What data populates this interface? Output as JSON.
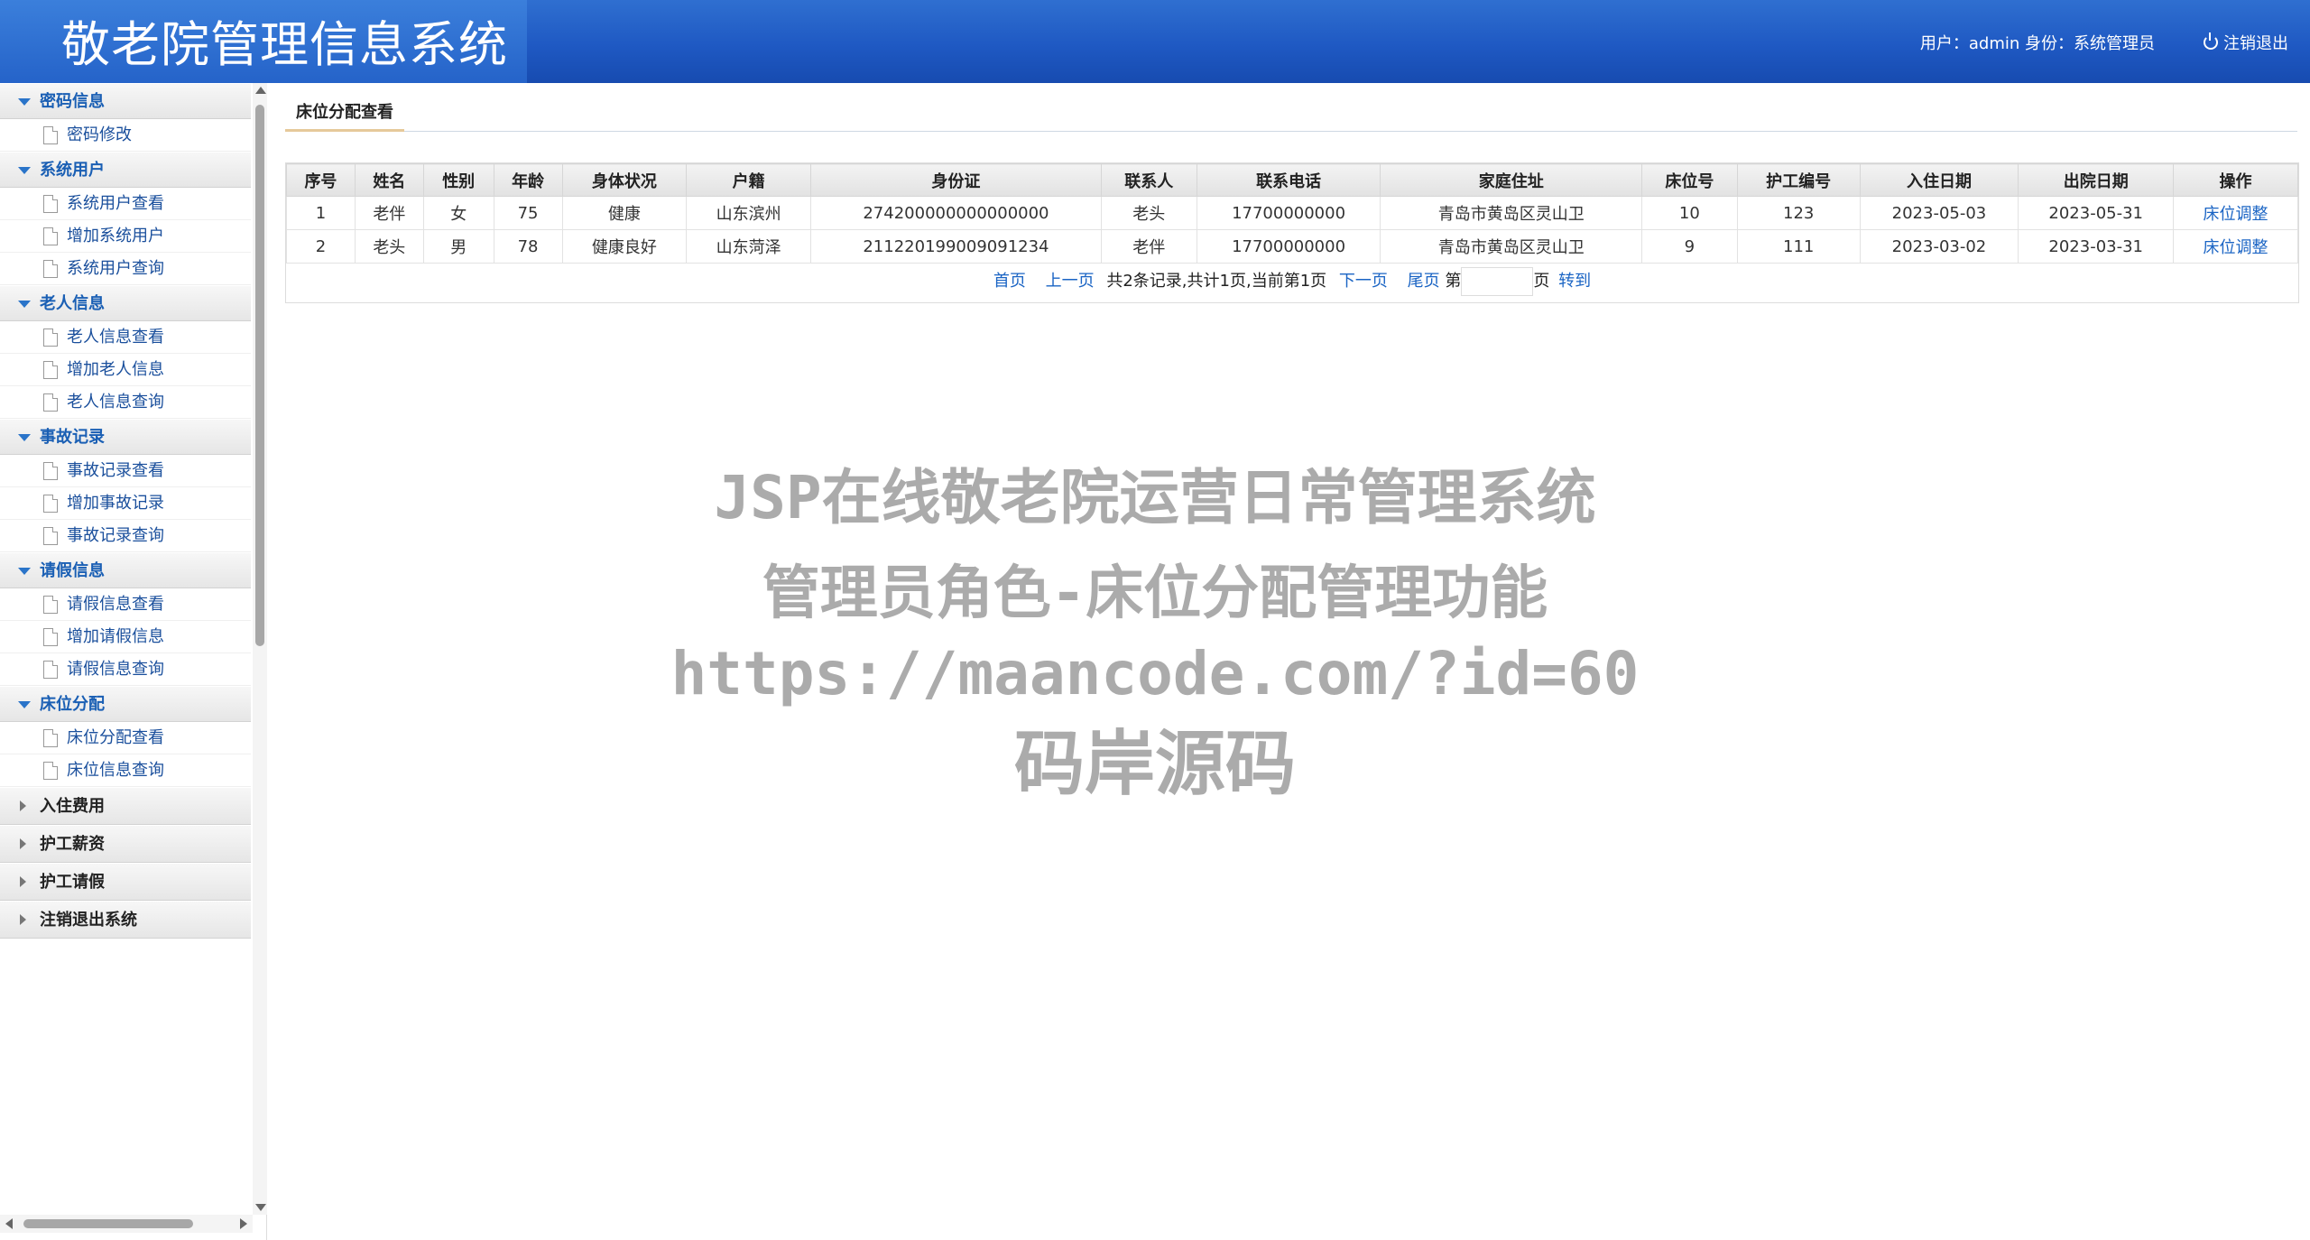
{
  "header": {
    "title": "敬老院管理信息系统",
    "user_info": "用户：admin 身份：系统管理员",
    "logout_label": "注销退出"
  },
  "sidebar": {
    "groups": [
      {
        "label": "密码信息",
        "items": [
          "密码修改"
        ]
      },
      {
        "label": "系统用户",
        "items": [
          "系统用户查看",
          "增加系统用户",
          "系统用户查询"
        ]
      },
      {
        "label": "老人信息",
        "items": [
          "老人信息查看",
          "增加老人信息",
          "老人信息查询"
        ]
      },
      {
        "label": "事故记录",
        "items": [
          "事故记录查看",
          "增加事故记录",
          "事故记录查询"
        ]
      },
      {
        "label": "请假信息",
        "items": [
          "请假信息查看",
          "增加请假信息",
          "请假信息查询"
        ]
      },
      {
        "label": "床位分配",
        "items": [
          "床位分配查看",
          "床位信息查询"
        ]
      }
    ],
    "collapsed": [
      "入住费用",
      "护工薪资",
      "护工请假",
      "注销退出系统"
    ]
  },
  "main": {
    "tab_label": "床位分配查看",
    "table": {
      "headers": [
        "序号",
        "姓名",
        "性别",
        "年龄",
        "身体状况",
        "户籍",
        "身份证",
        "联系人",
        "联系电话",
        "家庭住址",
        "床位号",
        "护工编号",
        "入住日期",
        "出院日期",
        "操作"
      ],
      "rows": [
        [
          "1",
          "老伴",
          "女",
          "75",
          "健康",
          "山东滨州",
          "274200000000000000",
          "老头",
          "17700000000",
          "青岛市黄岛区灵山卫",
          "10",
          "123",
          "2023-05-03",
          "2023-05-31",
          "床位调整"
        ],
        [
          "2",
          "老头",
          "男",
          "78",
          "健康良好",
          "山东菏泽",
          "211220199009091234",
          "老伴",
          "17700000000",
          "青岛市黄岛区灵山卫",
          "9",
          "111",
          "2023-03-02",
          "2023-03-31",
          "床位调整"
        ]
      ]
    },
    "pager": {
      "first": "首页",
      "prev": "上一页",
      "summary": "共2条记录,共计1页,当前第1页",
      "next": "下一页",
      "last": "尾页",
      "page_prefix": "第",
      "page_suffix": "页",
      "go": "转到"
    }
  },
  "watermark": {
    "line1": "JSP在线敬老院运营日常管理系统",
    "line2": "管理员角色-床位分配管理功能",
    "line3": "https://maancode.com/?id=60",
    "line4": "码岸源码"
  }
}
